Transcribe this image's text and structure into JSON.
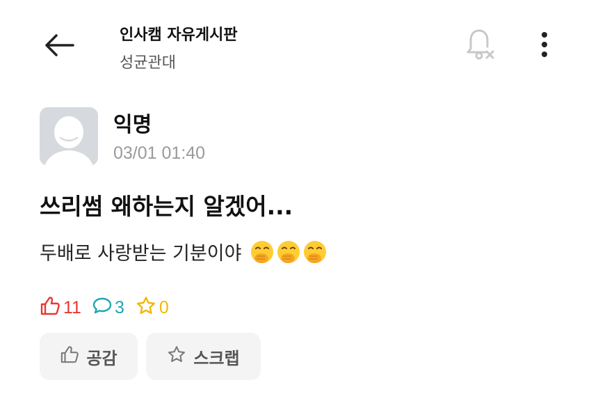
{
  "header": {
    "board_title": "인사캠 자유게시판",
    "school": "성균관대"
  },
  "post": {
    "author": "익명",
    "timestamp": "03/01 01:40",
    "title": "쓰리썸 왜하는지 알겠어...",
    "body": "두배로 사랑받는 기분이야",
    "emojis": [
      "face-with-hand-over-mouth",
      "face-with-hand-over-mouth",
      "face-with-hand-over-mouth"
    ]
  },
  "stats": {
    "likes": "11",
    "comments": "3",
    "scraps": "0"
  },
  "actions": {
    "like_label": "공감",
    "scrap_label": "스크랩"
  },
  "colors": {
    "like": "#e53935",
    "comment": "#1fa6b4",
    "scrap": "#f2b705",
    "avatar_bg": "#d6d9dd",
    "button_bg": "#f4f4f4"
  },
  "icons": {
    "back": "arrow-left-icon",
    "bell": "bell-off-icon",
    "more": "more-vertical-icon",
    "like": "thumbs-up-icon",
    "comment": "speech-bubble-icon",
    "scrap": "star-icon"
  }
}
